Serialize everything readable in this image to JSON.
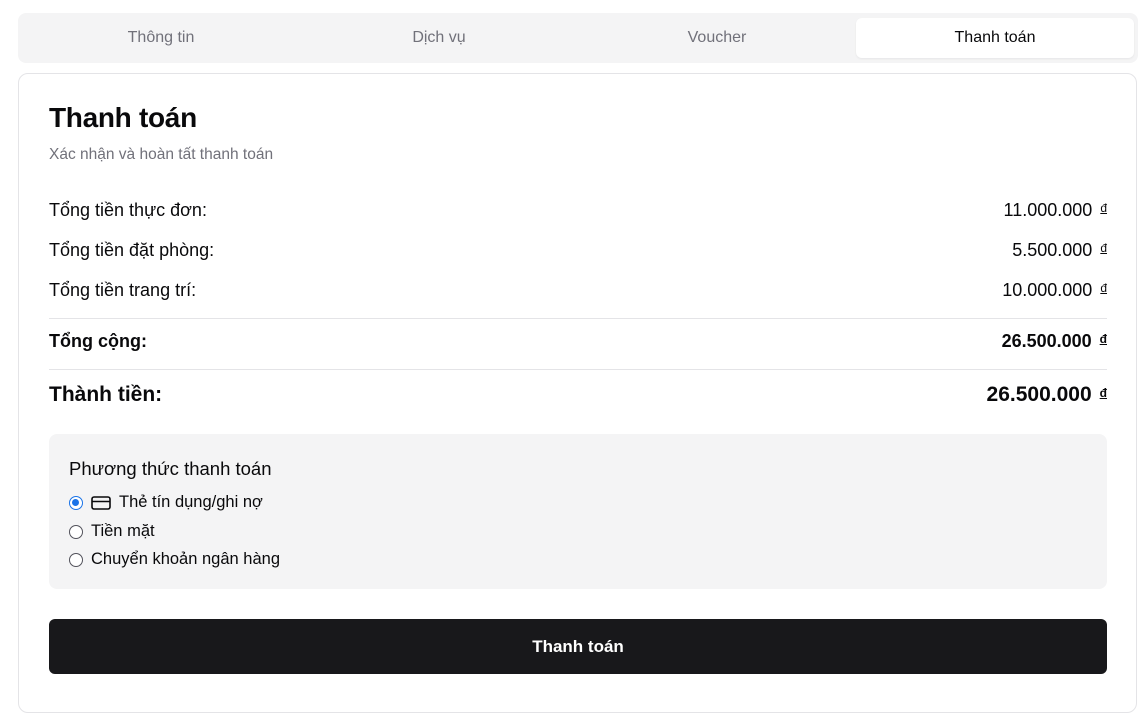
{
  "tabs": [
    {
      "label": "Thông tin",
      "active": false
    },
    {
      "label": "Dịch vụ",
      "active": false
    },
    {
      "label": "Voucher",
      "active": false
    },
    {
      "label": "Thanh toán",
      "active": true
    }
  ],
  "checkout": {
    "title": "Thanh toán",
    "subtitle": "Xác nhận và hoàn tất thanh toán",
    "currency_symbol": "đ",
    "lines": [
      {
        "label": "Tổng tiền thực đơn:",
        "amount": "11.000.000"
      },
      {
        "label": "Tổng tiền đặt phòng:",
        "amount": "5.500.000"
      },
      {
        "label": "Tổng tiền trang trí:",
        "amount": "10.000.000"
      }
    ],
    "subtotal": {
      "label": "Tổng cộng:",
      "amount": "26.500.000"
    },
    "grand_total": {
      "label": "Thành tiền:",
      "amount": "26.500.000"
    }
  },
  "payment": {
    "title": "Phương thức thanh toán",
    "options": [
      {
        "label": "Thẻ tín dụng/ghi nợ",
        "icon": "credit-card-icon",
        "selected": true
      },
      {
        "label": "Tiền mặt",
        "icon": "",
        "selected": false
      },
      {
        "label": "Chuyển khoản ngân hàng",
        "icon": "",
        "selected": false
      }
    ],
    "accent_color": "#1a73e8"
  },
  "submit_button": {
    "label": "Thanh toán"
  }
}
